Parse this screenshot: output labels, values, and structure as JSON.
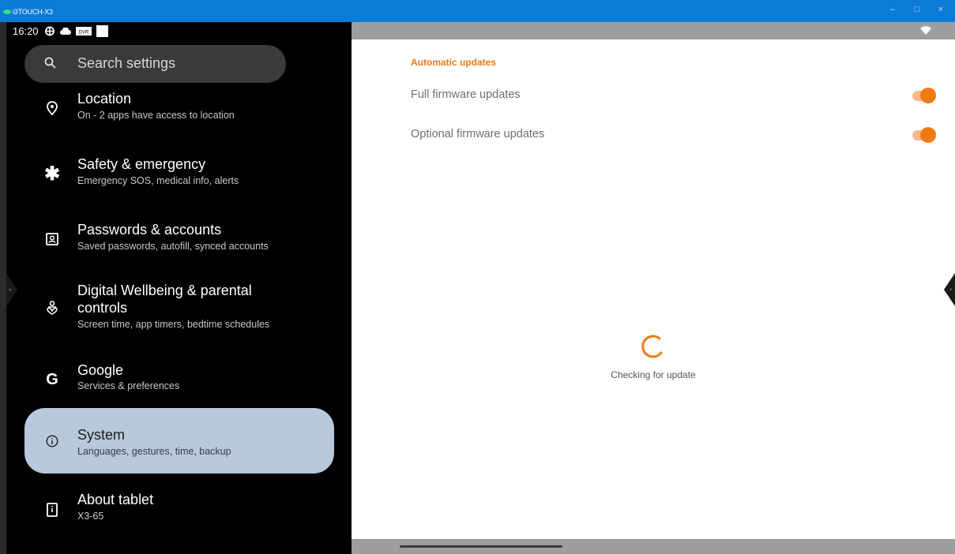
{
  "window": {
    "title": "i3TOUCH-X3",
    "minimize": "–",
    "maximize": "□",
    "close": "×"
  },
  "statusbar": {
    "time": "16:20",
    "icons": [
      "vpn-key-icon",
      "cloud-icon",
      "dvr-badge-icon",
      "white-box-icon",
      "wifi-icon"
    ],
    "dvr_text": "DVR"
  },
  "search": {
    "placeholder": "Search settings"
  },
  "settings_list": [
    {
      "icon": "location-pin-icon",
      "title": "Location",
      "subtitle": "On - 2 apps have access to location"
    },
    {
      "icon": "asterisk-icon",
      "title": "Safety & emergency",
      "subtitle": "Emergency SOS, medical info, alerts"
    },
    {
      "icon": "account-box-icon",
      "title": "Passwords & accounts",
      "subtitle": "Saved passwords, autofill, synced accounts"
    },
    {
      "icon": "wellbeing-icon",
      "title_line1": "Digital Wellbeing & parental",
      "title_line2": "controls",
      "subtitle": "Screen time, app timers, bedtime schedules"
    },
    {
      "icon": "google-g-icon",
      "title": "Google",
      "subtitle": "Services & preferences",
      "glyph": "G"
    },
    {
      "icon": "info-icon",
      "title": "System",
      "subtitle": "Languages, gestures, time, backup",
      "selected": true
    },
    {
      "icon": "tablet-info-icon",
      "title": "About tablet",
      "subtitle": "X3-65"
    }
  ],
  "detail": {
    "section_header": "Automatic updates",
    "prefs": [
      {
        "label": "Full firmware updates",
        "enabled": true
      },
      {
        "label": "Optional firmware updates",
        "enabled": true
      }
    ],
    "status_text": "Checking for update"
  },
  "colors": {
    "accent": "#ef7a17",
    "titlebar": "#0a7bd6",
    "selected_item": "#b8c9dc",
    "toggle_track": "#f7b98b"
  }
}
